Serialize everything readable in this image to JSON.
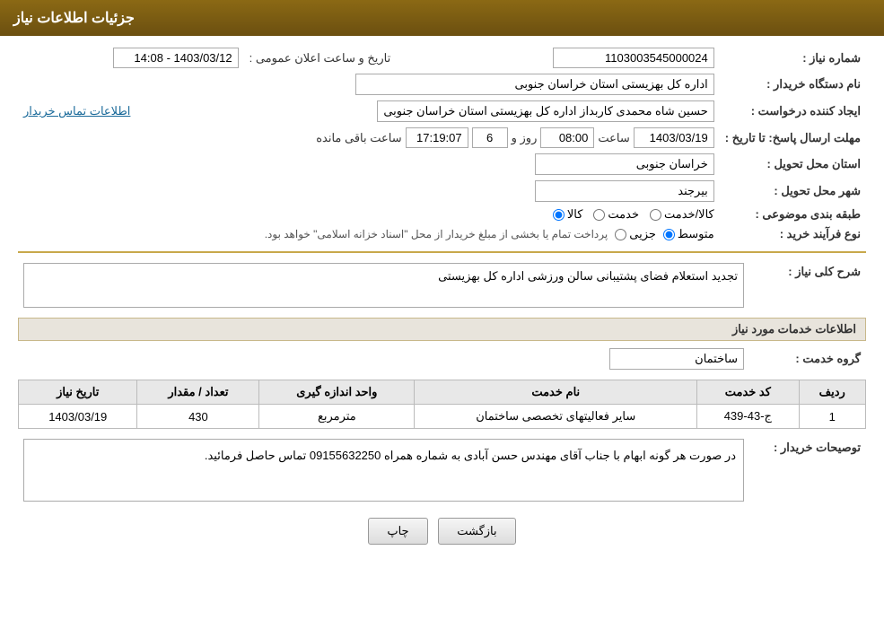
{
  "header": {
    "title": "جزئیات اطلاعات نیاز"
  },
  "fields": {
    "shomara_niaz_label": "شماره نیاز :",
    "shomara_niaz_value": "1103003545000024",
    "nam_dastgah_label": "نام دستگاه خریدار :",
    "nam_dastgah_value": "اداره کل بهزیستی استان خراسان جنوبی",
    "ijad_konande_label": "ایجاد کننده درخواست :",
    "ijad_konande_value": "حسین شاه محمدی کاربداز اداره کل بهزیستی استان خراسان جنوبی",
    "ettelaat_tamas_link": "اطلاعات تماس خریدار",
    "mohlat_label": "مهلت ارسال پاسخ: تا تاریخ :",
    "tarikh_value": "1403/03/19",
    "saat_label": "ساعت",
    "saat_value": "08:00",
    "rooz_label": "روز و",
    "rooz_value": "6",
    "baqi_label": "ساعت باقی مانده",
    "baqi_value": "17:19:07",
    "ostan_tahvil_label": "استان محل تحویل :",
    "ostan_tahvil_value": "خراسان جنوبی",
    "shahr_tahvil_label": "شهر محل تحویل :",
    "shahr_tahvil_value": "بیرجند",
    "taifeh_label": "طبقه بندی موضوعی :",
    "radio_kala": "کالا",
    "radio_khadamat": "خدمت",
    "radio_kala_khadamat": "کالا/خدمت",
    "nooe_farayand_label": "نوع فرآیند خرید :",
    "radio_jozee": "جزیی",
    "radio_motevaset": "متوسط",
    "nooe_farayand_desc": "پرداخت تمام یا بخشی از مبلغ خریدار از محل \"اسناد خزانه اسلامی\" خواهد بود.",
    "tarikh_saat_elan_label": "تاریخ و ساعت اعلان عمومی :",
    "tarikh_saat_elan_value": "1403/03/12 - 14:08",
    "sharh_koli_label": "شرح کلی نیاز :",
    "sharh_koli_value": "تجدید استعلام فضای پشتیبانی سالن ورزشی اداره کل بهزیستی",
    "ettelaat_khadamat_title": "اطلاعات خدمات مورد نیاز",
    "gorooh_khadamat_label": "گروه خدمت :",
    "gorooh_khadamat_value": "ساختمان",
    "table": {
      "headers": [
        "ردیف",
        "کد خدمت",
        "نام خدمت",
        "واحد اندازه گیری",
        "تعداد / مقدار",
        "تاریخ نیاز"
      ],
      "rows": [
        {
          "radif": "1",
          "kod_khadamat": "ج-43-439",
          "nam_khadamat": "سایر فعالیتهای تخصصی ساختمان",
          "vahed": "مترمربع",
          "tedad": "430",
          "tarikh_niaz": "1403/03/19"
        }
      ]
    },
    "tosifat_label": "توصیحات خریدار :",
    "tosifat_value": "در صورت هر گونه ابهام با جناب آقای مهندس حسن آبادی به شماره همراه 09155632250 تماس حاصل فرمائید."
  },
  "buttons": {
    "print_label": "چاپ",
    "back_label": "بازگشت"
  }
}
